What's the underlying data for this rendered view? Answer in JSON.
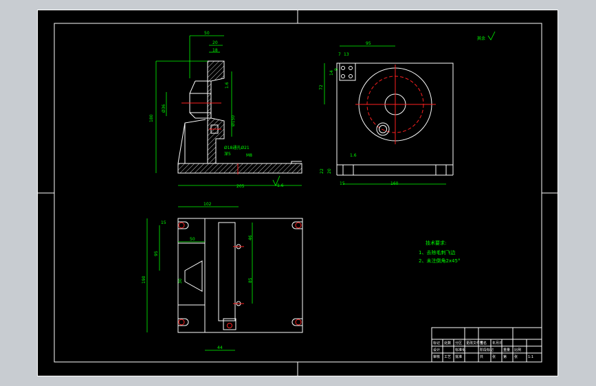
{
  "drawing": {
    "front_view": {
      "dims": {
        "d50": "50",
        "d20": "20",
        "d18": "18",
        "d180": "180",
        "d436": "Ø36",
        "d16": "1.6",
        "d35": "35",
        "d16b": "1.6",
        "phi150": "Ø150",
        "phi18": "Ø18通孔Ø21",
        "deep": "深5",
        "m8": "M8",
        "d205": "205",
        "d16c": "1.6"
      }
    },
    "top_view": {
      "dims": {
        "d95": "95",
        "d7": "7",
        "d13": "13",
        "d14": "14",
        "d9": "9",
        "d72": "72",
        "d16": "1.6",
        "d22": "22",
        "d20": "20",
        "d15": "15",
        "d160": "160"
      }
    },
    "bottom_view": {
      "dims": {
        "d102": "102",
        "d15": "15",
        "d95": "95",
        "d50": "50",
        "d190": "190",
        "d30": "30",
        "d46": "46",
        "d85": "85",
        "d44": "44"
      }
    },
    "roughness_note": "其余",
    "tech_requirements": {
      "title": "技术要求:",
      "items": [
        "1、去除毛刺飞边",
        "2、未注倒角2x45°"
      ]
    },
    "title_block": {
      "cells": [
        "标记",
        "处数",
        "分区",
        "更改文件号",
        "签名",
        "年月日",
        "设计",
        "标准化",
        "阶段标记",
        "重量",
        "比例",
        "审核",
        "工艺",
        "批准",
        "共",
        "张",
        "第",
        "张",
        "1:1"
      ]
    }
  },
  "colors": {
    "paper": "#000000",
    "outline": "#ffffff",
    "dimension": "#00ff00",
    "center": "#ff2020",
    "background": "#c8ccd1"
  }
}
